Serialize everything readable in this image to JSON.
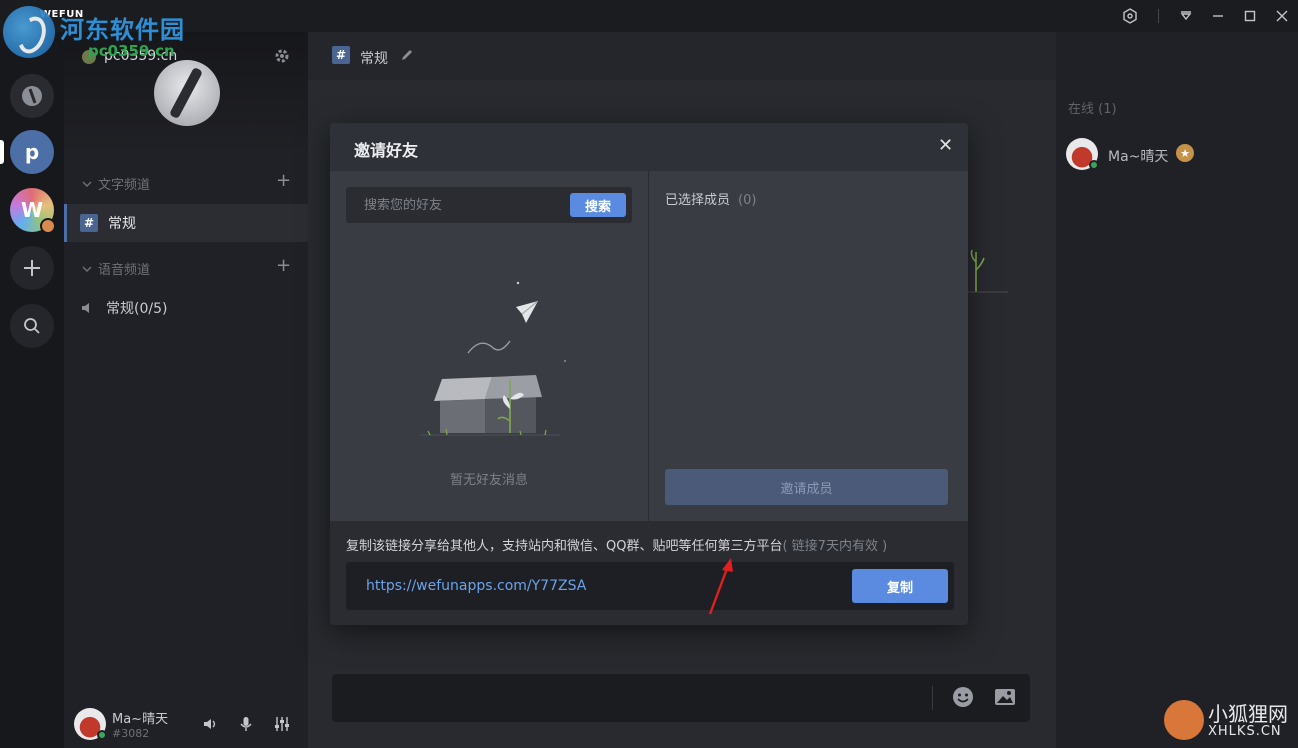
{
  "titlebar": {
    "app_name": "WEFUN"
  },
  "watermark": {
    "site": "河东软件园",
    "url": "pc0359.cn"
  },
  "rail": {
    "server_p": "p",
    "server_w": "W"
  },
  "channels": {
    "server_name": "pc0359.cn",
    "text_category": "文字频道",
    "voice_category": "语音频道",
    "text_items": [
      {
        "label": "常规",
        "prefix": "#"
      }
    ],
    "voice_items": [
      {
        "label": "常规(0/5)"
      }
    ]
  },
  "user": {
    "name": "Ma~晴天",
    "tag": "#3082"
  },
  "main": {
    "channel_hash": "#",
    "channel_title": "常规"
  },
  "members": {
    "header": "在线 (1)",
    "list": [
      {
        "name": "Ma~晴天"
      }
    ]
  },
  "modal": {
    "title": "邀请好友",
    "close": "✕",
    "search_placeholder": "搜索您的好友",
    "search_button": "搜索",
    "empty_text": "暂无好友消息",
    "selected_label": "已选择成员",
    "selected_count": "(0)",
    "invite_button": "邀请成员",
    "share_text": "复制该链接分享给其他人，支持站内和微信、QQ群、贴吧等任何第三方平台",
    "share_hint": "( 链接7天内有效 )",
    "link": "https://wefunapps.com/Y77ZSA",
    "copy_button": "复制"
  },
  "watermark2": {
    "name": "小狐狸网",
    "url": "XHLKS.CN"
  },
  "colors": {
    "accent": "#5b8be0",
    "link": "#6aa3e8",
    "online": "#3ba55c",
    "annotation": "#e02020"
  }
}
